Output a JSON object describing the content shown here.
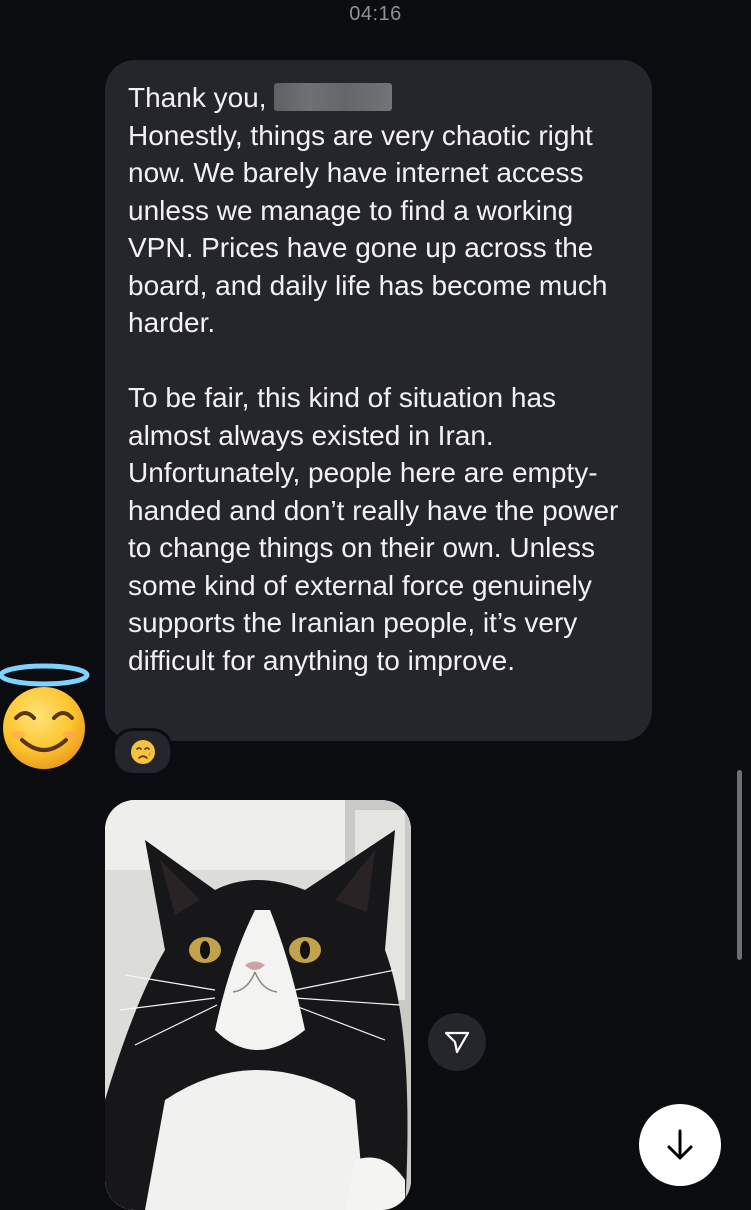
{
  "chat": {
    "timestamp": "04:16",
    "message": {
      "line1": "Thank you,",
      "paragraph1": "Honestly, things are very chaotic right now. We barely have internet access unless we manage to find a working VPN. Prices have gone up across the board, and daily life has become much harder.",
      "paragraph2": "To be fair, this kind of situation has almost always existed in Iran. Unfortunately, people here are empty-handed and don’t really have the power to change things on their own. Unless some kind of external force genuinely supports the Iranian people, it’s very difficult for anything to improve."
    },
    "reaction": "😢",
    "avatar": "smiling-face-with-halo",
    "photo": "black-and-white-persian-cat",
    "icons": {
      "share": "paper-plane-icon",
      "scroll_down": "arrow-down-icon"
    }
  }
}
